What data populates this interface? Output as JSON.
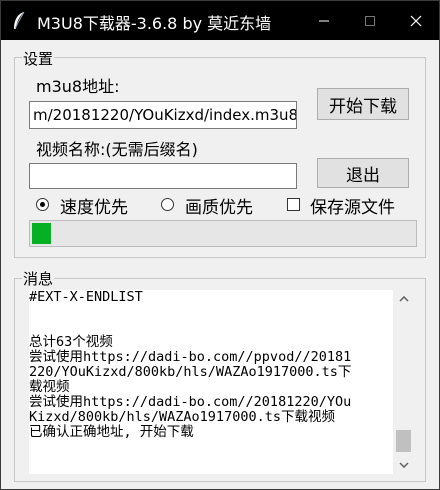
{
  "window": {
    "title": "M3U8下载器-3.6.8 by 莫近东墙",
    "icon": "feather-icon",
    "controls": [
      "minimize-icon",
      "maximize-icon",
      "close-icon"
    ]
  },
  "settings": {
    "group_title": "设置",
    "url_label": "m3u8地址:",
    "url_value": "m/20181220/YOuKizxd/index.m3u8",
    "start_button": "开始下载",
    "name_label": "视频名称:(无需后缀名)",
    "name_value": "",
    "exit_button": "退出",
    "speed_option": "速度优先",
    "quality_option": "画质优先",
    "save_source": "保存源文件",
    "selected_option": "speed",
    "save_source_checked": false,
    "progress_fraction": 0.05
  },
  "messages": {
    "group_title": "消息",
    "lines": [
      "#EXT-X-ENDLIST",
      "",
      "",
      "总计63个视频",
      "尝试使用https://dadi-bo.com//ppvod//20181",
      "220/YOuKizxd/800kb/hls/WAZAo1917000.ts下",
      "载视频",
      "尝试使用https://dadi-bo.com//20181220/YOu",
      "Kizxd/800kb/hls/WAZAo1917000.ts下载视频",
      "已确认正确地址, 开始下载"
    ]
  },
  "colors": {
    "titlebar": "#000000",
    "progress_fill": "#06b025",
    "button_face": "#e1e1e1"
  }
}
